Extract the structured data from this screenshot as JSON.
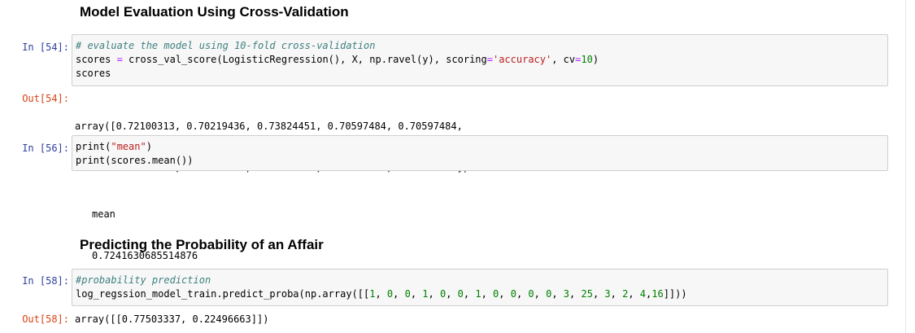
{
  "section1": {
    "heading": "Model Evaluation Using Cross-Validation"
  },
  "cell54": {
    "in_prompt": "In [54]:",
    "comment": "# evaluate the model using 10-fold cross-validation",
    "line2": {
      "var": "scores ",
      "eq": "=",
      "call": " cross_val_score(LogisticRegression(), X, np.ravel(y), scoring",
      "eq2": "=",
      "str": "'accuracy'",
      "mid": ", cv",
      "eq3": "=",
      "num": "10",
      "end": ")"
    },
    "line3": "scores",
    "out_prompt": "Out[54]:",
    "output_lines": [
      "array([0.72100313, 0.70219436, 0.73824451, 0.70597484, 0.70597484,",
      "       0.72955975, 0.7327044 , 0.70440252, 0.75157233, 0.75      ])"
    ]
  },
  "cell56": {
    "in_prompt": "In [56]:",
    "line1": {
      "pre": "print(",
      "str": "\"mean\"",
      "post": ")"
    },
    "line2": "print(scores.mean())",
    "stream_lines": [
      "mean",
      "0.7241630685514876"
    ]
  },
  "section2": {
    "heading": "Predicting the Probability of an Affair"
  },
  "cell58": {
    "in_prompt": "In [58]:",
    "comment": "#probability prediction",
    "line2": {
      "pre": "log_regssion_model_train.predict_proba(np.array([[",
      "nums": [
        {
          "v": "1",
          "sep": ", "
        },
        {
          "v": "0",
          "sep": ", "
        },
        {
          "v": "0",
          "sep": ", "
        },
        {
          "v": "1",
          "sep": ", "
        },
        {
          "v": "0",
          "sep": ", "
        },
        {
          "v": "0",
          "sep": ", "
        },
        {
          "v": "1",
          "sep": ", "
        },
        {
          "v": "0",
          "sep": ", "
        },
        {
          "v": "0",
          "sep": ", "
        },
        {
          "v": "0",
          "sep": ", "
        },
        {
          "v": "0",
          "sep": ", "
        },
        {
          "v": "3",
          "sep": ", "
        },
        {
          "v": "25",
          "sep": ", "
        },
        {
          "v": "3",
          "sep": ", "
        },
        {
          "v": "2",
          "sep": ", "
        },
        {
          "v": "4",
          "sep": ","
        },
        {
          "v": "16",
          "sep": ""
        }
      ],
      "post": "]]))"
    },
    "out_prompt": "Out[58]:",
    "output_line": "array([[0.77503337, 0.22496663]])"
  }
}
